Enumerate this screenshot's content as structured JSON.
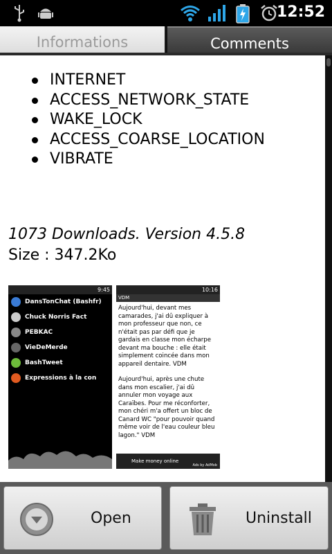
{
  "status_bar": {
    "time": "12:52",
    "icons": [
      "usb-icon",
      "android-debug-icon",
      "wifi-icon",
      "signal-icon",
      "battery-charging-icon",
      "alarm-icon"
    ]
  },
  "tabs": [
    {
      "label": "Informations",
      "selected": false
    },
    {
      "label": "Comments",
      "selected": true
    }
  ],
  "permissions": [
    "INTERNET",
    "ACCESS_NETWORK_STATE",
    "WAKE_LOCK",
    "ACCESS_COARSE_LOCATION",
    "VIBRATE"
  ],
  "stats": {
    "downloads": "1073 Downloads. Version 4.5.8",
    "size": "Size : 347.2Ko"
  },
  "screenshot1": {
    "time": "9:45",
    "apps": [
      {
        "label": "DansTonChat (Bashfr)",
        "color": "#3a7bd5"
      },
      {
        "label": "Chuck Norris Fact",
        "color": "#cccccc"
      },
      {
        "label": "PEBKAC",
        "color": "#888888"
      },
      {
        "label": "VieDeMerde",
        "color": "#666666"
      },
      {
        "label": "BashTweet",
        "color": "#6dbb3a"
      },
      {
        "label": "Expressions à la con",
        "color": "#e05a20"
      }
    ]
  },
  "screenshot2": {
    "time": "10:16",
    "title": "VDM",
    "story1": "Aujourd'hui, devant mes camarades, j'ai dû expliquer à mon professeur que non, ce n'était pas par défi que je gardais en classe mon écharpe devant ma bouche : elle était simplement coincée dans mon appareil dentaire. VDM",
    "story2": "Aujourd'hui, après une chute dans mon escalier, j'ai dû annuler mon voyage aux Caraïbes. Pour me réconforter, mon chéri m'a offert un bloc de Canard WC \"pour pouvoir quand même voir de l'eau couleur bleu lagon.\" VDM",
    "ad": "Make money online",
    "ad_credit": "Ads by AdMob"
  },
  "buttons": {
    "open": "Open",
    "uninstall": "Uninstall"
  }
}
